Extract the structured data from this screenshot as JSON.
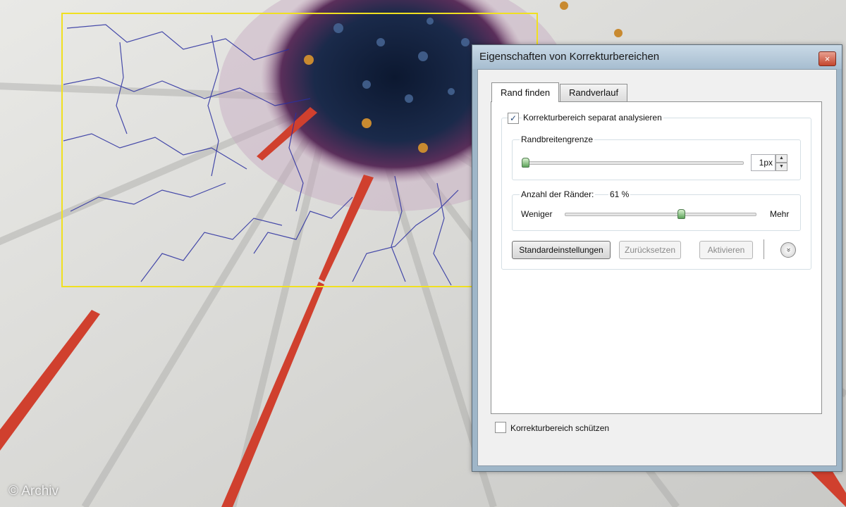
{
  "watermark": "© Archiv",
  "dialog": {
    "title": "Eigenschaften von Korrekturbereichen",
    "close_glyph": "×",
    "tabs": [
      {
        "label": "Rand finden",
        "active": true
      },
      {
        "label": "Randverlauf",
        "active": false
      }
    ],
    "analyze_separately": {
      "label": "Korrekturbereich separat analysieren",
      "checked": true,
      "check_glyph": "✓"
    },
    "edge_width": {
      "label": "Randbreitengrenze",
      "value": "1px",
      "slider_fraction": 0.0
    },
    "edge_count": {
      "label": "Anzahl der Ränder:",
      "value": "61 %",
      "less_label": "Weniger",
      "more_label": "Mehr",
      "slider_fraction": 0.61
    },
    "buttons": {
      "defaults": "Standardeinstellungen",
      "reset": "Zurücksetzen",
      "activate": "Aktivieren",
      "expand_glyph": "»"
    },
    "protect": {
      "label": "Korrekturbereich schützen",
      "checked": false
    }
  },
  "colors": {
    "selection_box": "#f0e020",
    "edge_lines": "#2a2fa0",
    "window_frame": "#9fb6c8"
  }
}
